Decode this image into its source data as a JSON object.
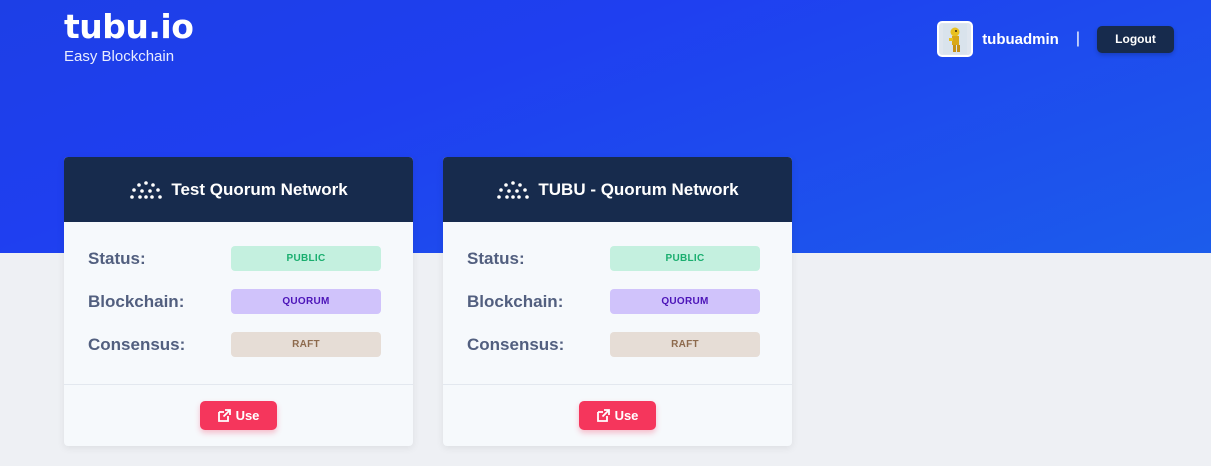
{
  "header": {
    "logo": "tubu.io",
    "tagline": "Easy Blockchain",
    "username": "tubuadmin",
    "separator": "|",
    "logout_label": "Logout",
    "avatar_icon": "user-avatar-icon"
  },
  "networks": [
    {
      "title": "Test Quorum Network",
      "rows": [
        {
          "label": "Status:",
          "value": "PUBLIC"
        },
        {
          "label": "Blockchain:",
          "value": "QUORUM"
        },
        {
          "label": "Consensus:",
          "value": "RAFT"
        }
      ],
      "action_label": "Use"
    },
    {
      "title": "TUBU - Quorum Network",
      "rows": [
        {
          "label": "Status:",
          "value": "PUBLIC"
        },
        {
          "label": "Blockchain:",
          "value": "QUORUM"
        },
        {
          "label": "Consensus:",
          "value": "RAFT"
        }
      ],
      "action_label": "Use"
    }
  ],
  "colors": {
    "header_gradient": "#1d3fe6",
    "card_header": "#172b4d",
    "use_button": "#f5365c",
    "status_badge": "#c4f0df",
    "chain_badge": "#d0c3fb",
    "consensus_badge": "#e6ddd6"
  }
}
